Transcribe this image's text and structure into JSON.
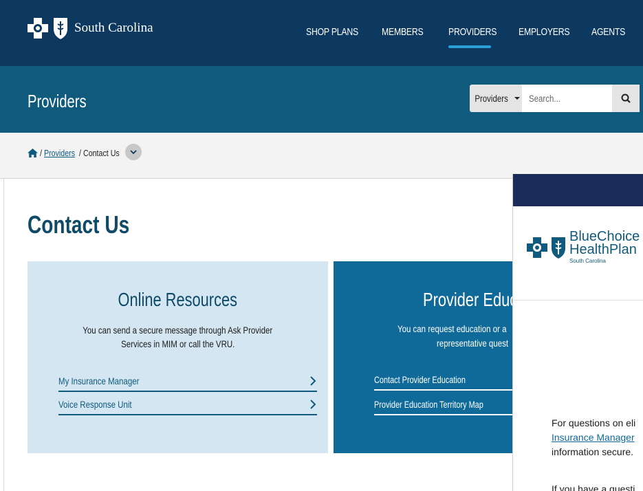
{
  "topnav": {
    "brand_text": "South Carolina",
    "items": [
      "SHOP PLANS",
      "MEMBERS",
      "PROVIDERS",
      "EMPLOYERS",
      "AGENTS"
    ],
    "active_item": "PROVIDERS"
  },
  "provbar": {
    "title": "Providers",
    "search_scope": "Providers",
    "search_placeholder": "Search..."
  },
  "breadcrumb": {
    "sep1": "/",
    "link": "Providers",
    "sep2": "/",
    "current": "Contact Us"
  },
  "main": {
    "title": "Contact Us",
    "online_card": {
      "heading": "Online Resources",
      "description_line1": "You can send a secure message through Ask Provider",
      "description_line2": "Services in MIM or call the VRU.",
      "links": [
        "My Insurance Manager",
        "Voice Response Unit"
      ]
    },
    "education_card": {
      "heading": "Provider Educ",
      "description_line1": "You can request education or a",
      "description_line2": "representative quest",
      "links": [
        "Contact Provider Education",
        "Provider Education Territory Map"
      ]
    }
  },
  "overlay": {
    "brand_line1": "BlueChoice",
    "brand_line2": "HealthPlan",
    "brand_sub": "South Carolina",
    "text_line1": "For questions on eli",
    "text_link": "Insurance Manager",
    "text_line3": "information secure.",
    "text_line4": "If you have a questi"
  },
  "colors": {
    "topnav_bg": "#0d3860",
    "provbar_bg": "#0f5a7d",
    "accent_underline": "#2aa0d8",
    "online_card_bg": "#d4e6f1",
    "education_card_bg": "#0f6a99"
  }
}
